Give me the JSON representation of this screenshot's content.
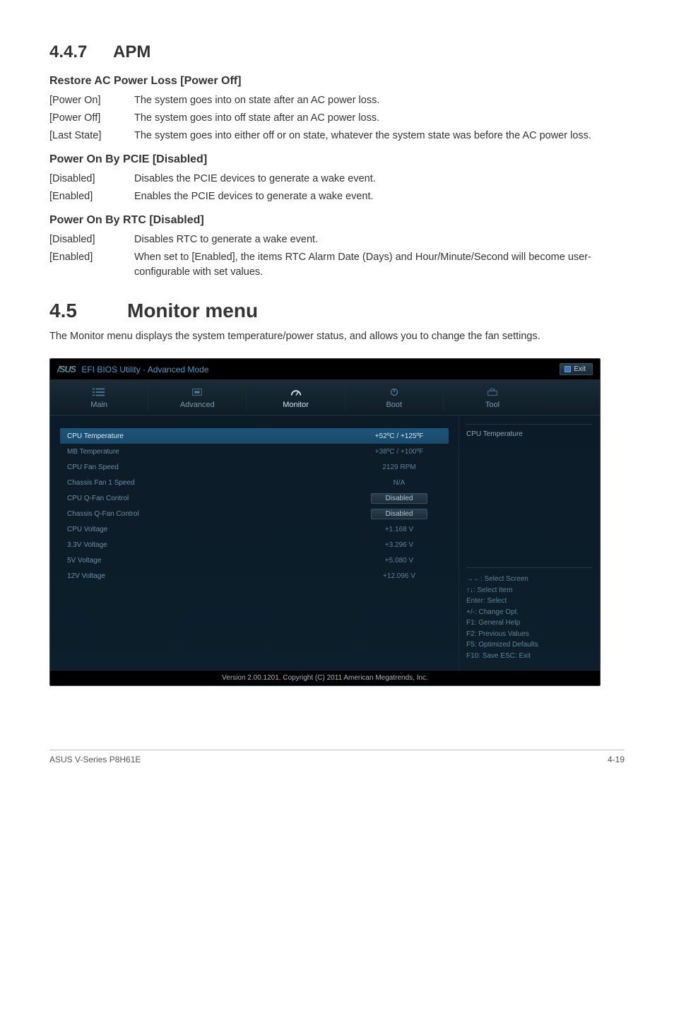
{
  "section_apm": {
    "num": "4.4.7",
    "title": "APM"
  },
  "restore": {
    "heading": "Restore AC Power Loss [Power Off]",
    "items": [
      {
        "k": "[Power On]",
        "v": "The system goes into on state after an AC power loss."
      },
      {
        "k": "[Power Off]",
        "v": "The system goes into off state after an AC power loss."
      },
      {
        "k": "[Last State]",
        "v": "The system goes into either off or on state, whatever the system state was before the AC power loss."
      }
    ]
  },
  "pcie": {
    "heading": "Power On By PCIE [Disabled]",
    "items": [
      {
        "k": "[Disabled]",
        "v": "Disables the PCIE devices to generate a wake event."
      },
      {
        "k": "[Enabled]",
        "v": "Enables the PCIE devices to generate a wake event."
      }
    ]
  },
  "rtc": {
    "heading": "Power On By RTC [Disabled]",
    "items": [
      {
        "k": "[Disabled]",
        "v": "Disables RTC to generate a wake event."
      },
      {
        "k": "[Enabled]",
        "v": "When set to [Enabled], the items RTC Alarm Date (Days) and Hour/Minute/Second will become user-configurable with set values."
      }
    ]
  },
  "monitor_section": {
    "num": "4.5",
    "title": "Monitor menu"
  },
  "monitor_intro": "The Monitor menu displays the system temperature/power status, and allows you to change the fan settings.",
  "bios": {
    "brand": "/SUS",
    "title": "EFI BIOS Utility - Advanced Mode",
    "exit": "Exit",
    "tabs": {
      "main": "Main",
      "advanced": "Advanced",
      "monitor": "Monitor",
      "boot": "Boot",
      "tool": "Tool"
    },
    "rows": [
      {
        "label": "CPU Temperature",
        "value": "+52ºC / +125ºF",
        "highlight": true,
        "box": false
      },
      {
        "label": "MB Temperature",
        "value": "+38ºC / +100ºF",
        "highlight": false,
        "box": false
      },
      {
        "label": "CPU Fan Speed",
        "value": "2129 RPM",
        "highlight": false,
        "box": false
      },
      {
        "label": "Chassis Fan 1 Speed",
        "value": "N/A",
        "highlight": false,
        "box": false
      },
      {
        "label": "CPU Q-Fan Control",
        "value": "Disabled",
        "highlight": false,
        "box": true
      },
      {
        "label": "Chassis Q-Fan Control",
        "value": "Disabled",
        "highlight": false,
        "box": true
      },
      {
        "label": "CPU Voltage",
        "value": "+1.168 V",
        "highlight": false,
        "box": false
      },
      {
        "label": "3.3V Voltage",
        "value": "+3.296 V",
        "highlight": false,
        "box": false
      },
      {
        "label": "5V Voltage",
        "value": "+5.080 V",
        "highlight": false,
        "box": false
      },
      {
        "label": "12V Voltage",
        "value": "+12.096 V",
        "highlight": false,
        "box": false
      }
    ],
    "right_title": "CPU Temperature",
    "help": [
      "→←: Select Screen",
      "↑↓: Select Item",
      "Enter: Select",
      "+/-: Change Opt.",
      "F1: General Help",
      "F2: Previous Values",
      "F5: Optimized Defaults",
      "F10: Save   ESC: Exit"
    ],
    "footer": "Version 2.00.1201.   Copyright (C) 2011 American Megatrends, Inc."
  },
  "page_footer": {
    "left": "ASUS V-Series P8H61E",
    "right": "4-19"
  }
}
